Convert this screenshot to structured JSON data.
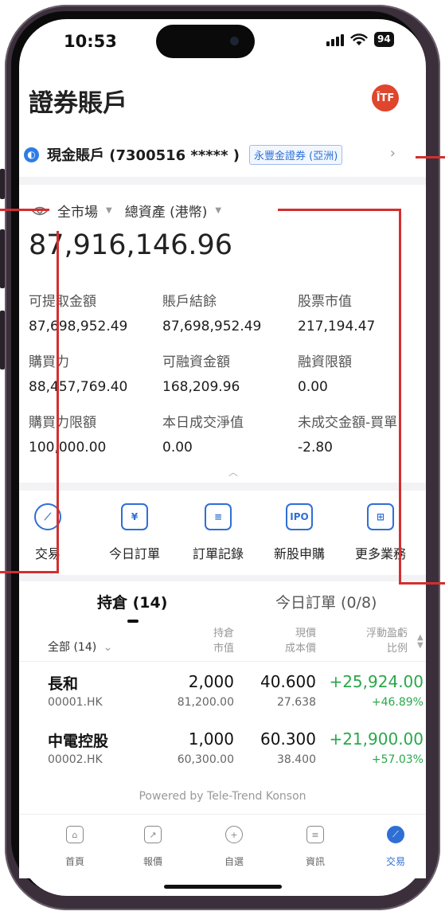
{
  "status_bar": {
    "time": "10:53",
    "battery": "94"
  },
  "header": {
    "title": "證券賬戶",
    "logo_text": "ĪTF"
  },
  "account": {
    "name": "現金賬戶 (7300516 ***** )",
    "broker": "永豐金證券 (亞洲)"
  },
  "asset_filter": {
    "market": "全市場",
    "view": "總資產 (港幣)"
  },
  "total_asset": "87,916,146.96",
  "metrics": [
    {
      "label": "可提取金額",
      "value": "87,698,952.49"
    },
    {
      "label": "賬戶結餘",
      "value": "87,698,952.49"
    },
    {
      "label": "股票市值",
      "value": "217,194.47"
    },
    {
      "label": "購買力",
      "value": "88,457,769.40"
    },
    {
      "label": "可融資金額",
      "value": "168,209.96"
    },
    {
      "label": "融資限額",
      "value": "0.00"
    },
    {
      "label": "購買力限額",
      "value": "100,000.00"
    },
    {
      "label": "本日成交淨值",
      "value": "0.00"
    },
    {
      "label": "未成交金額-買單",
      "value": "-2.80"
    }
  ],
  "quick_actions": [
    {
      "label": "交易",
      "icon": "trade-icon"
    },
    {
      "label": "今日訂單",
      "icon": "calendar-icon"
    },
    {
      "label": "訂單記錄",
      "icon": "order-history-icon"
    },
    {
      "label": "新股申購",
      "icon": "ipo-icon"
    },
    {
      "label": "更多業務",
      "icon": "grid-icon"
    }
  ],
  "ipo_badge": "IPO",
  "tabs": {
    "positions": "持倉 (14)",
    "orders": "今日訂單 (0/8)"
  },
  "table_header": {
    "filter": "全部 (14)",
    "col1_top": "持倉",
    "col1_bottom": "市值",
    "col2_top": "現價",
    "col2_bottom": "成本價",
    "col3_top": "浮動盈虧",
    "col3_bottom": "比例"
  },
  "holdings": [
    {
      "name": "長和",
      "code": "00001.HK",
      "qty": "2,000",
      "market_value": "81,200.00",
      "price": "40.600",
      "cost": "27.638",
      "pnl": "+25,924.00",
      "pct": "+46.89%"
    },
    {
      "name": "中電控股",
      "code": "00002.HK",
      "qty": "1,000",
      "market_value": "60,300.00",
      "price": "60.300",
      "cost": "38.400",
      "pnl": "+21,900.00",
      "pct": "+57.03%"
    }
  ],
  "powered_by": "Powered by Tele-Trend Konson",
  "bottom_nav": [
    {
      "label": "首頁",
      "icon": "home-icon"
    },
    {
      "label": "報價",
      "icon": "chart-icon"
    },
    {
      "label": "自選",
      "icon": "add-icon"
    },
    {
      "label": "資訊",
      "icon": "news-icon"
    },
    {
      "label": "交易",
      "icon": "trade-icon"
    }
  ],
  "colors": {
    "accent": "#2e6fd6",
    "gain": "#2aa84a",
    "annotation": "#d32f2f",
    "logo": "#e0452d"
  }
}
